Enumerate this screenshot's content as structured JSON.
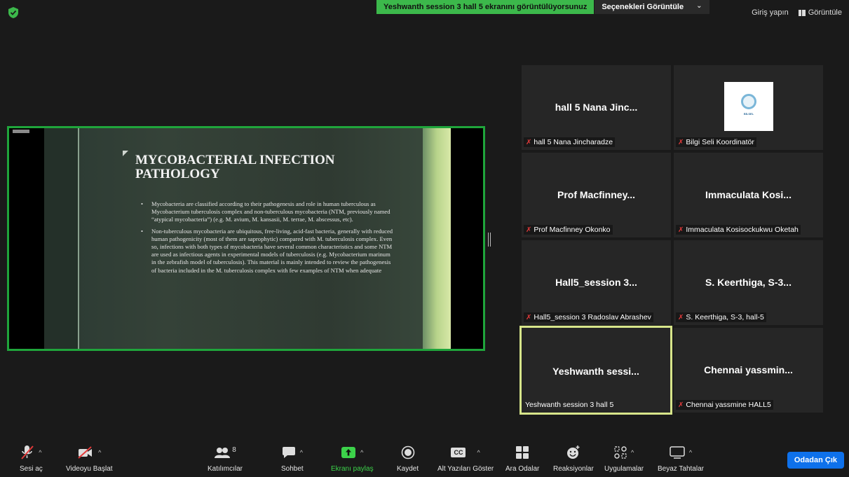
{
  "top": {
    "banner_text": "Yeshwanth session 3 hall 5 ekranını görüntülüyorsunuz",
    "options_label": "Seçenekleri Görüntüle",
    "options_chevron": "⌄",
    "signin_label": "Giriş yapın",
    "view_label": "Görüntüle"
  },
  "slide": {
    "title": "MYCOBACTERIAL INFECTION PATHOLOGY",
    "bullets": [
      "Mycobacteria are classified according to their pathogenesis and role in human tuberculous as Mycobacterium tuberculosis complex and non-tuberculous mycobacteria (NTM, previously named “atypical mycobacteria”) (e.g. M. avium, M. kansasii, M. terrae, M. abscessus, etc).",
      "Non-tuberculous mycobacteria are ubiquitous, free-living, acid-fast bacteria, generally with reduced human pathogenicity (most of them are saprophytic) compared with M. tuberculosis complex. Even so, infections with both types of mycobacteria have several common characteristics and some NTM are used as infectious agents in experimental models of tuberculosis (e.g. Mycobacterium marinum in the zebrafish model of tuberculosis). This material is mainly intended to review the pathogenesis of bacteria included in the M. tuberculosis complex with few examples of NTM when adequate"
    ]
  },
  "gallery": [
    {
      "name": "hall 5 Nana Jinc...",
      "label": "hall 5 Nana Jincharadze",
      "muted": true
    },
    {
      "name": "",
      "label": "Bilgi Seli Koordinatör",
      "muted": true,
      "logo_text": "BİLSEL"
    },
    {
      "name": "Prof Macfinney...",
      "label": "Prof Macfinney Okonko",
      "muted": true
    },
    {
      "name": "Immaculata Kosi...",
      "label": "Immaculata Kosisockukwu Oketah",
      "muted": true
    },
    {
      "name": "Hall5_session 3...",
      "label": "Hall5_session 3 Radoslav Abrashev",
      "muted": true
    },
    {
      "name": "S. Keerthiga, S-3...",
      "label": "S. Keerthiga, S-3, hall-5",
      "muted": true
    },
    {
      "name": "Yeshwanth sessi...",
      "label": "Yeshwanth session 3 hall 5",
      "muted": false
    },
    {
      "name": "Chennai yassmin...",
      "label": "Chennai yassmine HALL5",
      "muted": true
    }
  ],
  "toolbar": {
    "audio": "Sesi aç",
    "video": "Videoyu Başlat",
    "participants": "Katılımcılar",
    "participants_count": "8",
    "chat": "Sohbet",
    "share": "Ekranı paylaş",
    "record": "Kaydet",
    "captions": "Alt Yazıları Göster",
    "cc": "CC",
    "breakout": "Ara Odalar",
    "reactions": "Reaksiyonlar",
    "apps": "Uygulamalar",
    "whiteboard": "Beyaz Tahtalar",
    "leave": "Odadan Çık"
  },
  "colors": {
    "share_green": "#3cb84b",
    "active_speaker": "#d7e58a",
    "leave_blue": "#0e71eb",
    "mute_red": "#e23a3a"
  }
}
